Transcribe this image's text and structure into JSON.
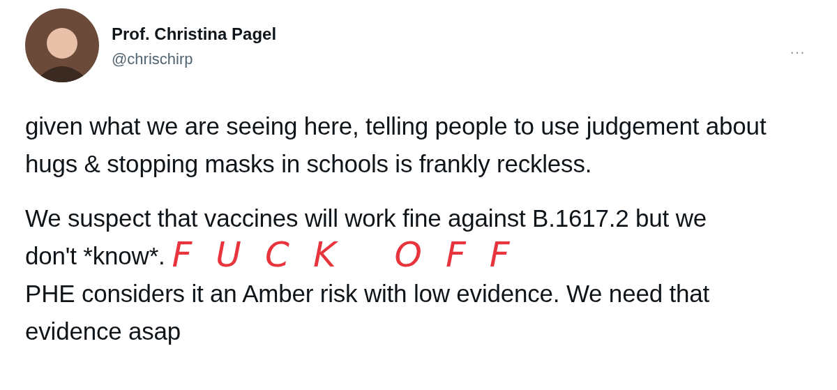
{
  "author": {
    "name": "Prof. Christina Pagel",
    "handle": "@chrischirp",
    "menu": "···"
  },
  "paragraphs": [
    [
      "given what we are seeing here, telling people to use judgement about hugs & stopping masks in schools is frankly reckless."
    ],
    [
      "We suspect that vaccines will work fine against B.1617.2 but we",
      "don't *know*.",
      "PHE considers it an Amber risk with low evidence. We need that evidence asap"
    ]
  ],
  "annotation": {
    "text": "FUCK OFF",
    "color": "#e8343c"
  }
}
